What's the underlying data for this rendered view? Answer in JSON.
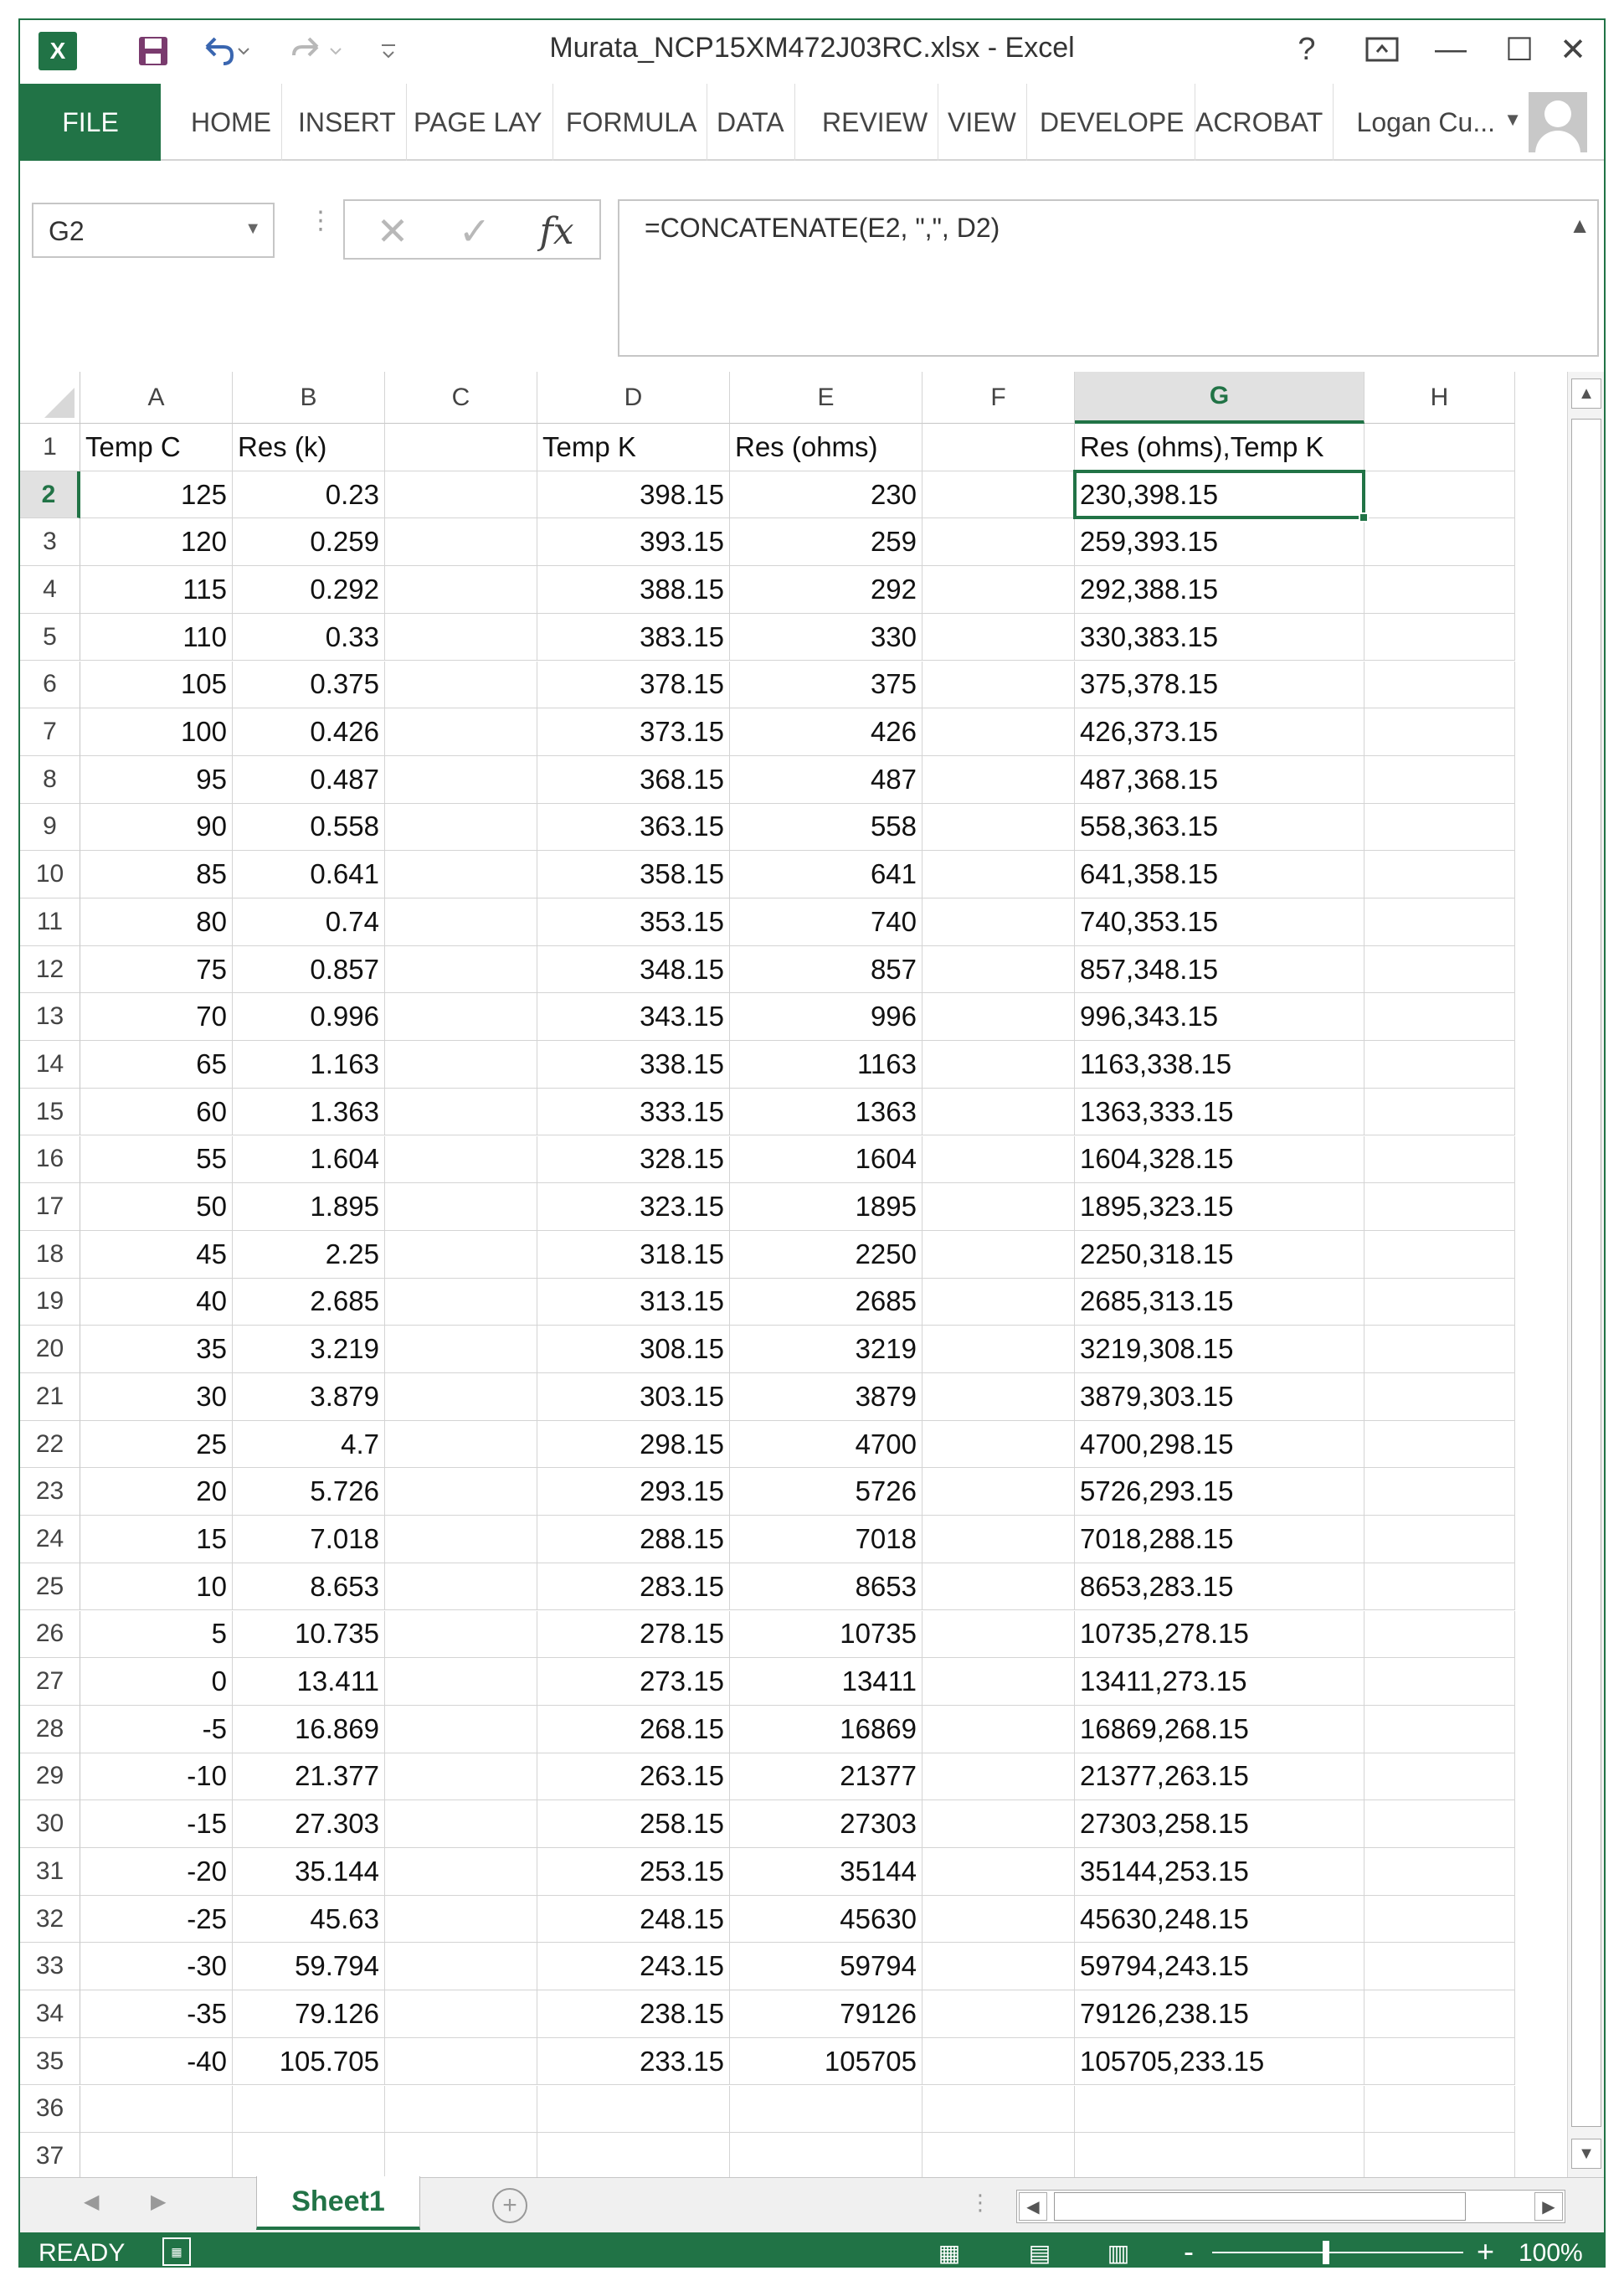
{
  "window": {
    "title": "Murata_NCP15XM472J03RC.xlsx - Excel",
    "app_icon": "X",
    "controls": {
      "help": "?",
      "ribbon_options": "⊡",
      "minimize": "—",
      "maximize": "☐",
      "close": "✕"
    }
  },
  "quick_access": {
    "save_icon": "floppy-icon",
    "undo_icon": "undo-icon",
    "redo_icon": "redo-icon"
  },
  "ribbon": {
    "tabs": [
      "FILE",
      "HOME",
      "INSERT",
      "PAGE LAY",
      "FORMULA",
      "DATA",
      "REVIEW",
      "VIEW",
      "DEVELOPE",
      "ACROBAT"
    ],
    "user_name": "Logan Cu..."
  },
  "formula_bar": {
    "name_box": "G2",
    "formula": "=CONCATENATE(E2, \",\", D2)",
    "cancel_glyph": "✕",
    "enter_glyph": "✓",
    "fx_glyph": "fx"
  },
  "grid": {
    "columns": [
      "A",
      "B",
      "C",
      "D",
      "E",
      "F",
      "G",
      "H"
    ],
    "selected_column": "G",
    "selected_row": "2",
    "row_numbers": [
      "1",
      "2",
      "3",
      "4",
      "5",
      "6",
      "7",
      "8",
      "9",
      "10",
      "11",
      "12",
      "13",
      "14",
      "15",
      "16",
      "17",
      "18",
      "19",
      "20",
      "21",
      "22",
      "23",
      "24",
      "25",
      "26",
      "27",
      "28",
      "29",
      "30",
      "31",
      "32",
      "33",
      "34",
      "35",
      "36",
      "37"
    ],
    "headers": {
      "A": "Temp C",
      "B": "Res (k)",
      "D": "Temp K",
      "E": "Res (ohms)",
      "G": "Res (ohms),Temp K"
    },
    "rows": [
      [
        "125",
        "0.23",
        "398.15",
        "230",
        "230,398.15"
      ],
      [
        "120",
        "0.259",
        "393.15",
        "259",
        "259,393.15"
      ],
      [
        "115",
        "0.292",
        "388.15",
        "292",
        "292,388.15"
      ],
      [
        "110",
        "0.33",
        "383.15",
        "330",
        "330,383.15"
      ],
      [
        "105",
        "0.375",
        "378.15",
        "375",
        "375,378.15"
      ],
      [
        "100",
        "0.426",
        "373.15",
        "426",
        "426,373.15"
      ],
      [
        "95",
        "0.487",
        "368.15",
        "487",
        "487,368.15"
      ],
      [
        "90",
        "0.558",
        "363.15",
        "558",
        "558,363.15"
      ],
      [
        "85",
        "0.641",
        "358.15",
        "641",
        "641,358.15"
      ],
      [
        "80",
        "0.74",
        "353.15",
        "740",
        "740,353.15"
      ],
      [
        "75",
        "0.857",
        "348.15",
        "857",
        "857,348.15"
      ],
      [
        "70",
        "0.996",
        "343.15",
        "996",
        "996,343.15"
      ],
      [
        "65",
        "1.163",
        "338.15",
        "1163",
        "1163,338.15"
      ],
      [
        "60",
        "1.363",
        "333.15",
        "1363",
        "1363,333.15"
      ],
      [
        "55",
        "1.604",
        "328.15",
        "1604",
        "1604,328.15"
      ],
      [
        "50",
        "1.895",
        "323.15",
        "1895",
        "1895,323.15"
      ],
      [
        "45",
        "2.25",
        "318.15",
        "2250",
        "2250,318.15"
      ],
      [
        "40",
        "2.685",
        "313.15",
        "2685",
        "2685,313.15"
      ],
      [
        "35",
        "3.219",
        "308.15",
        "3219",
        "3219,308.15"
      ],
      [
        "30",
        "3.879",
        "303.15",
        "3879",
        "3879,303.15"
      ],
      [
        "25",
        "4.7",
        "298.15",
        "4700",
        "4700,298.15"
      ],
      [
        "20",
        "5.726",
        "293.15",
        "5726",
        "5726,293.15"
      ],
      [
        "15",
        "7.018",
        "288.15",
        "7018",
        "7018,288.15"
      ],
      [
        "10",
        "8.653",
        "283.15",
        "8653",
        "8653,283.15"
      ],
      [
        "5",
        "10.735",
        "278.15",
        "10735",
        "10735,278.15"
      ],
      [
        "0",
        "13.411",
        "273.15",
        "13411",
        "13411,273.15"
      ],
      [
        "-5",
        "16.869",
        "268.15",
        "16869",
        "16869,268.15"
      ],
      [
        "-10",
        "21.377",
        "263.15",
        "21377",
        "21377,263.15"
      ],
      [
        "-15",
        "27.303",
        "258.15",
        "27303",
        "27303,258.15"
      ],
      [
        "-20",
        "35.144",
        "253.15",
        "35144",
        "35144,253.15"
      ],
      [
        "-25",
        "45.63",
        "248.15",
        "45630",
        "45630,248.15"
      ],
      [
        "-30",
        "59.794",
        "243.15",
        "59794",
        "59794,243.15"
      ],
      [
        "-35",
        "79.126",
        "238.15",
        "79126",
        "79126,238.15"
      ],
      [
        "-40",
        "105.705",
        "233.15",
        "105705",
        "105705,233.15"
      ]
    ]
  },
  "sheets": {
    "active": "Sheet1",
    "add_glyph": "+"
  },
  "status_bar": {
    "status": "READY",
    "zoom": "100%",
    "zoom_minus": "-",
    "zoom_plus": "+"
  },
  "theme": {
    "accent": "#217346"
  }
}
